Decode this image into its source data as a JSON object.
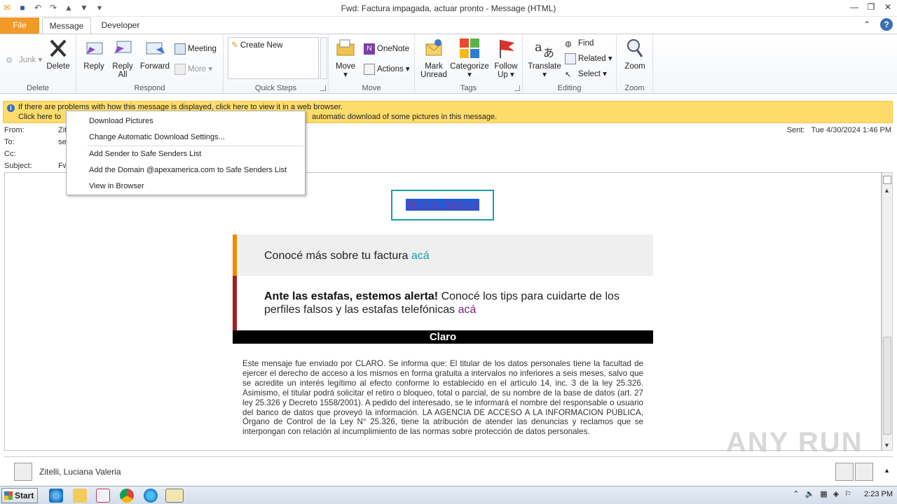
{
  "window": {
    "title": "Fwd: Factura impagada, actuar pronto  -  Message (HTML)"
  },
  "tabs": {
    "file": "File",
    "message": "Message",
    "developer": "Developer"
  },
  "ribbon": {
    "delete_group": {
      "junk": "Junk",
      "delete": "Delete",
      "label": "Delete"
    },
    "respond_group": {
      "reply": "Reply",
      "reply_all_1": "Reply",
      "reply_all_2": "All",
      "forward": "Forward",
      "meeting": "Meeting",
      "more": "More",
      "label": "Respond"
    },
    "quicksteps_group": {
      "create_new": "Create New",
      "label": "Quick Steps"
    },
    "move_group": {
      "move": "Move",
      "onenote": "OneNote",
      "actions": "Actions",
      "label": "Move"
    },
    "tags_group": {
      "mark_unread_1": "Mark",
      "mark_unread_2": "Unread",
      "categorize": "Categorize",
      "follow_up_1": "Follow",
      "follow_up_2": "Up",
      "label": "Tags"
    },
    "editing_group": {
      "translate": "Translate",
      "find": "Find",
      "related": "Related",
      "select": "Select",
      "label": "Editing"
    },
    "zoom_group": {
      "zoom": "Zoom",
      "label": "Zoom"
    }
  },
  "infobar": {
    "line1": "If there are problems with how this message is displayed, click here to view it in a web browser.",
    "line2a": "Click here to",
    "line2b": "automatic download of some pictures in this message."
  },
  "headers": {
    "from_label": "From:",
    "from_value": "Zit",
    "to_label": "To:",
    "to_value": "se",
    "cc_label": "Cc:",
    "subject_label": "Subject:",
    "subject_value": "Fw",
    "sent_label": "Sent:",
    "sent_value": "Tue 4/30/2024 1:46 PM"
  },
  "context_menu": {
    "download_pictures": "Download Pictures",
    "change_settings": "Change Automatic Download Settings...",
    "add_sender": "Add Sender to Safe Senders List",
    "add_domain": "Add the Domain @apexamerica.com to Safe Senders List",
    "view_browser": "View in Browser"
  },
  "email": {
    "cta": "Mirá tu factura",
    "panel1_text": "Conocé más sobre tu factura ",
    "panel1_link": "acá",
    "panel2_bold": "Ante las estafas, estemos alerta!",
    "panel2_text": " Conocé los tips para cuidarte de los perfiles falsos y las estafas telefónicas ",
    "panel2_link": "acá",
    "brand": "Claro",
    "legal": "Este mensaje fue enviado por CLARO. Se informa que: El titular de los datos personales tiene la facultad de ejercer el derecho de acceso a los mismos en forma gratuita a intervalos no inferiores a seis meses, salvo que se acredite un interés legítimo al efecto conforme lo establecido en el artículo 14, inc. 3 de la ley 25.326. Asimismo, el titular podrá solicitar el retiro o bloqueo, total o parcial, de su nombre de la base de datos (art. 27 ley 25.326 y Decreto 1558/2001). A pedido del interesado, se le informará el nombre del responsable o usuario del banco de datos que proveyó la información. LA AGENCIA DE ACCESO A LA INFORMACION PÚBLICA, Órgano de Control de la Ley N° 25.326, tiene la atribución de atender las denuncias y reclamos que se interpongan con relación al incumplimiento de las normas sobre protección de datos personales."
  },
  "people_pane": {
    "name": "Zitelli, Luciana Valeria"
  },
  "watermark": "ANY RUN",
  "taskbar": {
    "start": "Start",
    "clock": "2:23 PM"
  },
  "colors": {
    "file_tab": "#f19a27",
    "infobar": "#fddc6c",
    "cta_border": "#19a0a0",
    "accent_orange": "#f08a00",
    "accent_red": "#a3201e",
    "link_teal": "#11a0a6"
  }
}
